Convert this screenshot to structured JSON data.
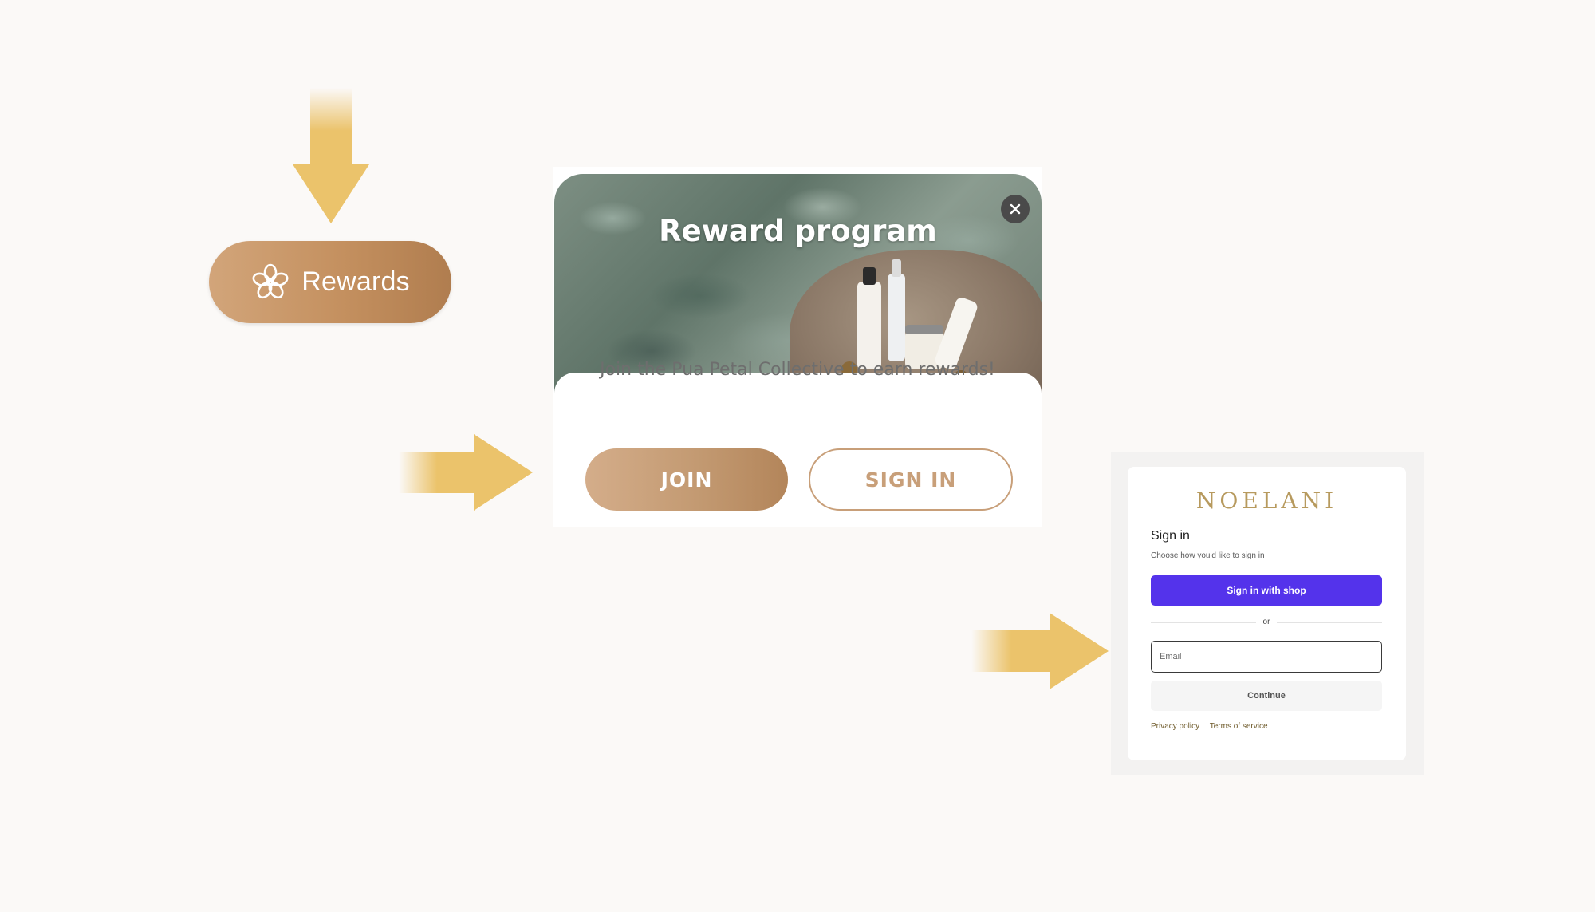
{
  "launcher": {
    "label": "Rewards",
    "icon": "flower-icon"
  },
  "reward_panel": {
    "title": "Reward program",
    "tagline": "Join the Pua Petal Collective to earn rewards!",
    "join_label": "JOIN",
    "signin_label": "SIGN IN",
    "close_icon": "close-icon"
  },
  "signin": {
    "brand": "NOELANI",
    "title": "Sign in",
    "subtitle": "Choose how you'd like to sign in",
    "shop_button": "Sign in with shop",
    "or_text": "or",
    "email_placeholder": "Email",
    "continue_label": "Continue",
    "links": [
      "Privacy policy",
      "Terms of service"
    ]
  },
  "colors": {
    "page_background": "#fbf9f7",
    "arrow": "#ebc36b",
    "rewards_gradient_start": "#d2a57a",
    "rewards_gradient_end": "#b07d4f",
    "signin_outline": "#c89f79",
    "shop_purple": "#5433eb",
    "brand_gold": "#b79a5e"
  }
}
